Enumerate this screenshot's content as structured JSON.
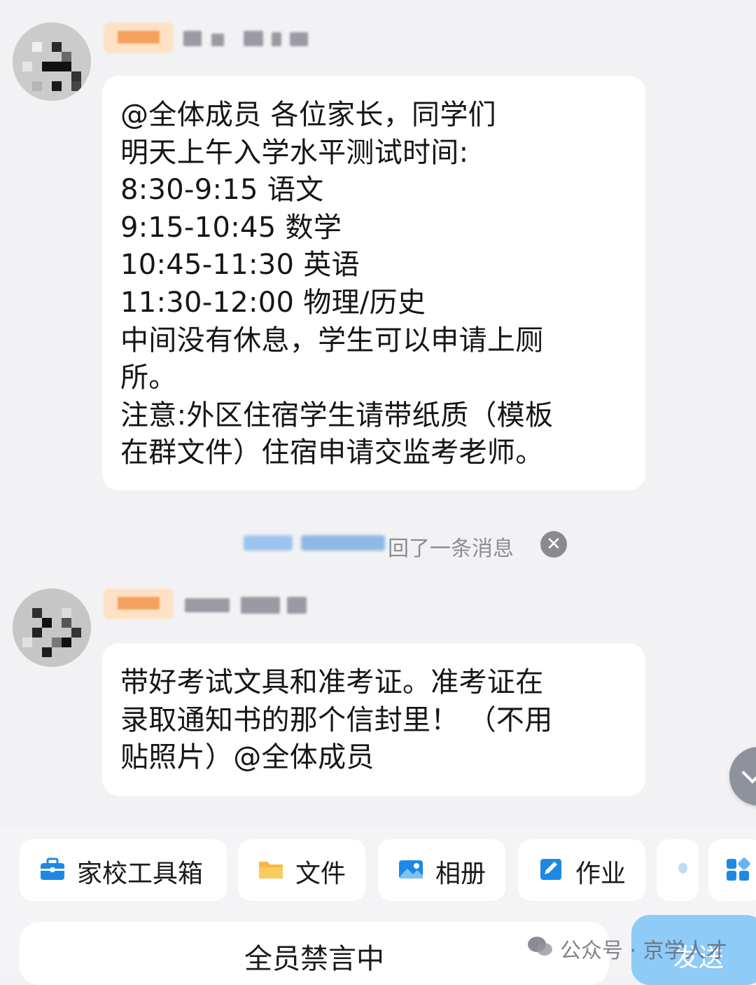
{
  "messages": [
    {
      "text": "@全体成员 各位家长，同学们\n明天上午入学水平测试时间:\n8:30-9:15 语文\n9:15-10:45 数学\n10:45-11:30 英语\n11:30-12:00 物理/历史\n中间没有休息，学生可以申请上厕\n所。\n注意:外区住宿学生请带纸质（模板\n在群文件）住宿申请交监考老师。"
    },
    {
      "text": "带好考试文具和准考证。准考证在\n录取通知书的那个信封里！ （不用\n贴照片）@全体成员"
    }
  ],
  "recall_notice": "回了一条消息",
  "toolbar": {
    "items": [
      {
        "label": "家校工具箱",
        "icon": "toolbox-icon",
        "color": "#1e88e5"
      },
      {
        "label": "文件",
        "icon": "folder-icon",
        "color": "#f5b942"
      },
      {
        "label": "相册",
        "icon": "album-icon",
        "color": "#1e88e5"
      },
      {
        "label": "作业",
        "icon": "homework-icon",
        "color": "#1e88e5"
      }
    ]
  },
  "mute_text": "全员禁言中",
  "send_label": "发送",
  "watermark": "公众号 · 京学人才",
  "colors": {
    "background": "#f2f2f4",
    "bubble": "#ffffff",
    "accent": "#1e88e5",
    "send_button": "#8ecbf6",
    "role_badge": "#fde1c4"
  }
}
